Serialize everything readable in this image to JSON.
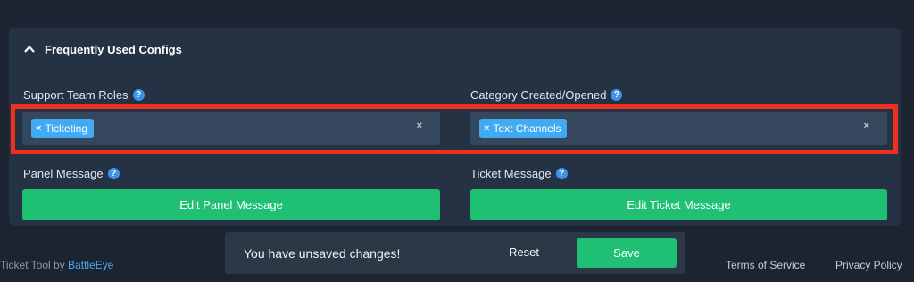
{
  "section": {
    "title": "Frequently Used Configs",
    "chevron_icon": "chevron-up-icon"
  },
  "fields": {
    "support_roles": {
      "label": "Support Team Roles",
      "help_glyph": "?",
      "tag": "Ticketing"
    },
    "category": {
      "label": "Category Created/Opened",
      "help_glyph": "?",
      "tag": "Text Channels"
    },
    "panel_message": {
      "label": "Panel Message",
      "help_glyph": "?",
      "button": "Edit Panel Message"
    },
    "ticket_message": {
      "label": "Ticket Message",
      "help_glyph": "?",
      "button": "Edit Ticket Message"
    }
  },
  "remove_glyph": "×",
  "footer": {
    "credit_prefix": "Ticket Tool by",
    "credit_link": "BattleEye",
    "terms": "Terms of Service",
    "privacy": "Privacy Policy"
  },
  "unsaved": {
    "message": "You have unsaved changes!",
    "reset": "Reset",
    "save": "Save"
  },
  "colors": {
    "background": "#1b2430",
    "panel": "#253243",
    "accent_green": "#1fbf74",
    "tag_blue": "#42aaf2",
    "highlight_red": "#f2301f"
  }
}
